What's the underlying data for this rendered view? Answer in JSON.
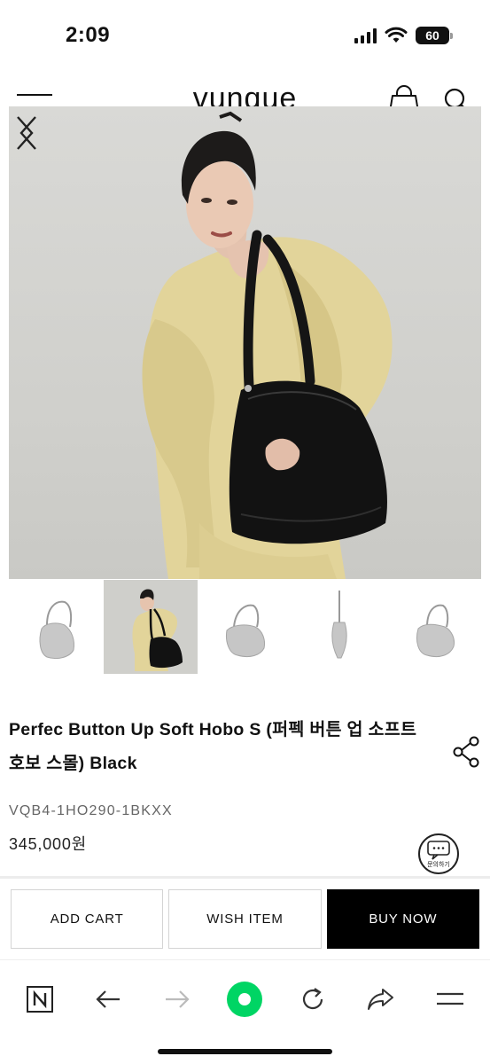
{
  "status_bar": {
    "time": "2:09",
    "battery": "60"
  },
  "header": {
    "logo": "vunque",
    "icons": [
      "menu-icon",
      "shopping-bag-icon",
      "search-icon"
    ]
  },
  "gallery": {
    "prev_icon": "chevron-left-icon",
    "next_icon": "chevron-right-icon",
    "thumbnails": [
      "bag-front",
      "model-wearing",
      "bag-angle",
      "bag-side",
      "bag-back"
    ],
    "active_thumbnail_index": 1
  },
  "product": {
    "title": "Perfec Button Up Soft Hobo S (퍼펙 버튼 업 소프트 호보 스몰) Black",
    "sku": "VQB4-1HO290-1BKXX",
    "price": "345,000원",
    "chat_label": "문의하기"
  },
  "actions": {
    "add_cart": "ADD CART",
    "wish_item": "WISH ITEM",
    "buy_now": "BUY NOW"
  },
  "browser_bar": {
    "icons": [
      "naver-icon",
      "back-arrow-icon",
      "forward-arrow-icon",
      "green-home-icon",
      "refresh-icon",
      "share-arrow-icon",
      "menu-icon"
    ]
  },
  "colors": {
    "accent_green": "#00d564",
    "buy_now_bg": "#000000",
    "hero_bg": "#d2d2ce",
    "sweater": "#e2d49a"
  }
}
